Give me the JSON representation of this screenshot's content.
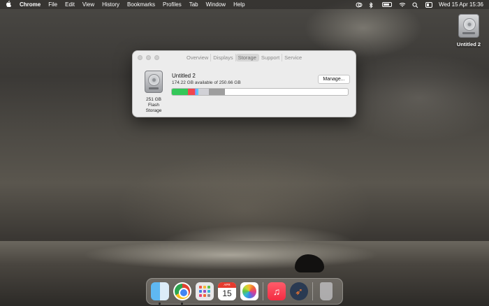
{
  "menubar": {
    "app_name": "Chrome",
    "menus": [
      "File",
      "Edit",
      "View",
      "History",
      "Bookmarks",
      "Profiles",
      "Tab",
      "Window",
      "Help"
    ],
    "clock": "Wed 15 Apr  15:36"
  },
  "desktop": {
    "drive_label": "Untitled 2"
  },
  "window": {
    "tabs": [
      "Overview",
      "Displays",
      "Storage",
      "Support",
      "Service"
    ],
    "active_tab": "Storage",
    "drive_size": "251 GB",
    "drive_type": "Flash Storage",
    "volume_name": "Untitled 2",
    "volume_available": "174.22 GB available of 250.66 GB",
    "manage_label": "Manage...",
    "usage_segments": [
      {
        "color": "#34c759",
        "fraction": 0.09
      },
      {
        "color": "#f0474f",
        "fraction": 0.04
      },
      {
        "color": "#8e8cf0",
        "fraction": 0.01
      },
      {
        "color": "#5ac8fa",
        "fraction": 0.01
      },
      {
        "color": "#d1d1d6",
        "fraction": 0.06
      },
      {
        "color": "#9e9e9e",
        "fraction": 0.09
      }
    ]
  },
  "dock": {
    "apps": [
      "finder",
      "chrome",
      "launchpad",
      "calendar",
      "photos",
      "music",
      "rocket",
      "trash"
    ],
    "calendar_month": "APR",
    "calendar_day": "15"
  }
}
